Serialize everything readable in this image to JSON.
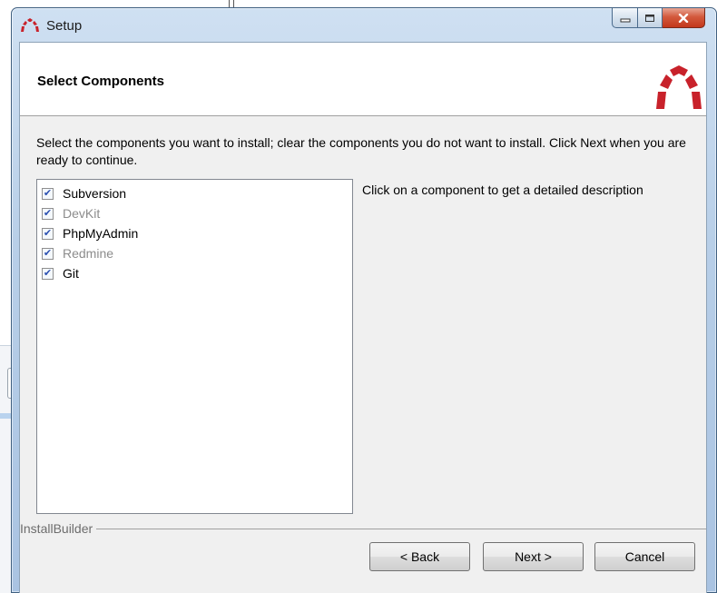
{
  "window": {
    "title": "Setup",
    "caption_buttons": {
      "minimize": "minimize",
      "maximize": "maximize",
      "close": "x"
    }
  },
  "header": {
    "title": "Select Components"
  },
  "instructions": "Select the components you want to install; clear the components you do not want to install. Click Next when you are ready to continue.",
  "components": [
    {
      "label": "Subversion",
      "checked": true,
      "enabled": true
    },
    {
      "label": "DevKit",
      "checked": true,
      "enabled": false
    },
    {
      "label": "PhpMyAdmin",
      "checked": true,
      "enabled": true
    },
    {
      "label": "Redmine",
      "checked": true,
      "enabled": false
    },
    {
      "label": "Git",
      "checked": true,
      "enabled": true
    }
  ],
  "description": "Click on a component to get a detailed description",
  "branding": "InstallBuilder",
  "buttons": {
    "back": "< Back",
    "next": "Next >",
    "cancel": "Cancel"
  },
  "colors": {
    "logo_red": "#c8222b",
    "checkmark": "#2a4fb0",
    "close_button": "#c3371c"
  },
  "icons": {
    "app": "redmine-arch-icon",
    "check": "checkmark-icon"
  }
}
